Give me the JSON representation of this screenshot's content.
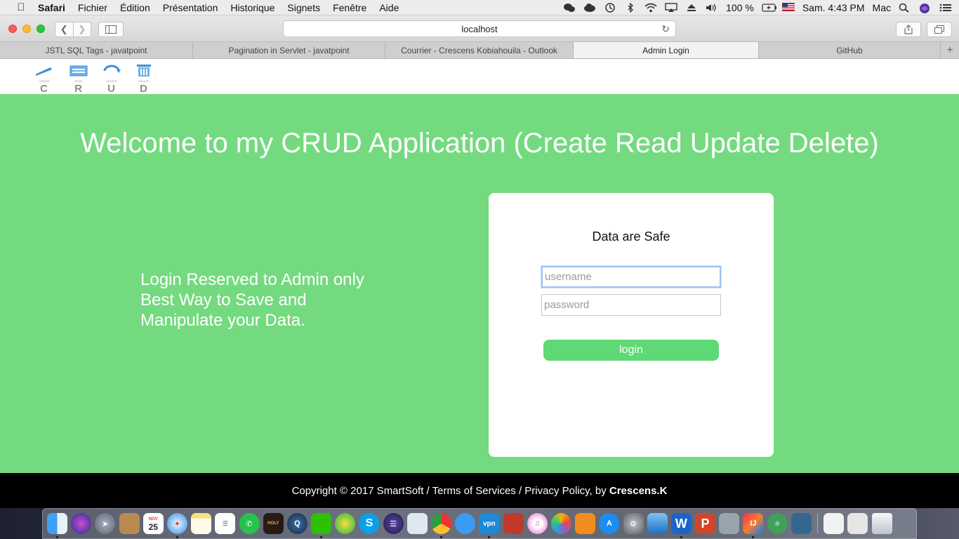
{
  "menubar": {
    "app_name": "Safari",
    "items": [
      "Fichier",
      "Édition",
      "Présentation",
      "Historique",
      "Signets",
      "Fenêtre",
      "Aide"
    ],
    "battery": "100 %",
    "clock": "Sam. 4:43 PM",
    "user": "Mac"
  },
  "toolbar": {
    "url": "localhost"
  },
  "tabs": [
    {
      "label": "JSTL SQL Tags - javatpoint",
      "active": false
    },
    {
      "label": "Pagination in Servlet - javatpoint",
      "active": false
    },
    {
      "label": "Courrier - Crescens Kobiahouila - Outlook",
      "active": false
    },
    {
      "label": "Admin Login",
      "active": true
    },
    {
      "label": "GitHub",
      "active": false
    }
  ],
  "logo": {
    "icons": [
      "CREATE",
      "READ",
      "UPDATE",
      "DELETE"
    ],
    "letters": [
      "C",
      "R",
      "U",
      "D"
    ]
  },
  "page": {
    "welcome": "Welcome to my CRUD Application (Create Read Update Delete)",
    "tagline": [
      "Login Reserved to Admin only",
      "Best Way to Save and",
      "Manipulate your Data."
    ],
    "card_title": "Data are Safe",
    "username_placeholder": "username",
    "password_placeholder": "password",
    "login_label": "login"
  },
  "footer": {
    "text": "Copyright © 2017 SmartSoft / Terms of Services / Privacy Policy, by ",
    "author": "Crescens.K"
  },
  "colors": {
    "page_background": "#74da7f",
    "login_button": "#5fd876",
    "footer": "#000000"
  },
  "dock": {
    "calendar_day": "25",
    "calendar_month": "NOV",
    "vpn_label": "vpn",
    "icons": [
      "finder-icon",
      "siri-icon",
      "launchpad-icon",
      "contacts-icon",
      "calendar-icon",
      "safari-icon",
      "notes-icon",
      "reminders-icon",
      "whatsapp-icon",
      "bible-icon",
      "quicktime-icon",
      "wechat-icon",
      "app-icon",
      "skype-icon",
      "eclipse-icon",
      "preview-icon",
      "chrome-icon",
      "messages-icon",
      "vpn-icon",
      "photo-booth-icon",
      "itunes-icon",
      "photos-icon",
      "ibooks-icon",
      "app-store-icon",
      "system-preferences-icon",
      "xcode-icon",
      "word-icon",
      "powerpoint-icon",
      "network-icon",
      "intellij-icon",
      "atom-icon",
      "postgres-icon",
      "finder-window-icon",
      "screen-icon",
      "trash-icon"
    ]
  }
}
